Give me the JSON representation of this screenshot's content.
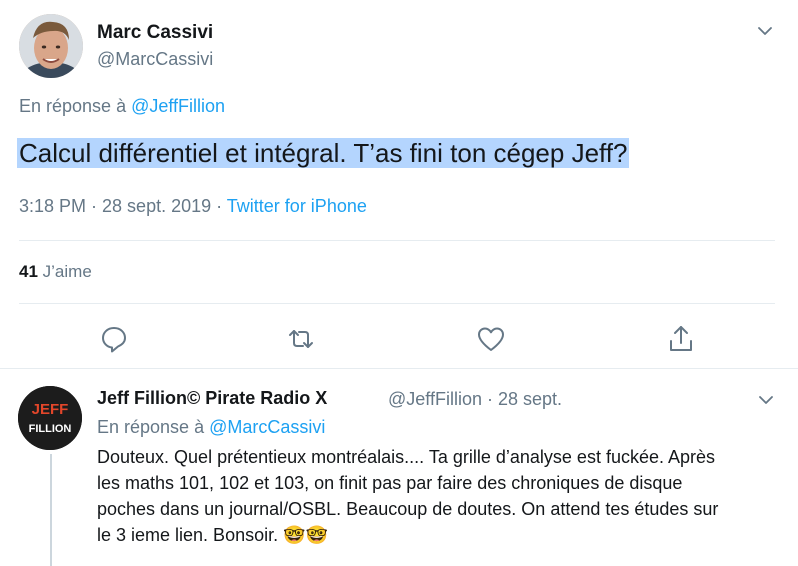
{
  "main_tweet": {
    "display_name": "Marc Cassivi",
    "handle": "@MarcCassivi",
    "reply_prefix": "En réponse à ",
    "reply_to": "@JeffFillion",
    "text": "Calcul différentiel et intégral. T’as fini ton cégep Jeff?",
    "timestamp": "3:18 PM · 28 sept. 2019 · ",
    "source": "Twitter for iPhone",
    "like_count": "41",
    "like_label": " J’aime"
  },
  "reply_tweet": {
    "display_name": "Jeff Fillion© Pirate Radio X",
    "handle_time": "@JeffFillion · 28 sept.",
    "reply_prefix": "En réponse à ",
    "reply_to": "@MarcCassivi",
    "text": "Douteux. Quel prétentieux montréalais.... Ta grille d’analyse est fuckée. Après les maths 101, 102 et 103, on finit pas par faire des chroniques de disque poches dans un journal/OSBL. Beaucoup de doutes. On attend tes études sur le 3 ieme lien. Bonsoir. ",
    "emojis": "🤓🤓",
    "avatar_logo_top": "JEFF",
    "avatar_logo_bottom": "FILLION"
  },
  "icons": {
    "caret": "chevron-down-icon",
    "reply": "reply-icon",
    "retweet": "retweet-icon",
    "like": "like-icon",
    "share": "share-icon"
  },
  "colors": {
    "link": "#1da1f2",
    "secondary_text": "#657786",
    "selection": "#b4d5fe",
    "divider": "#e6ecf0"
  }
}
